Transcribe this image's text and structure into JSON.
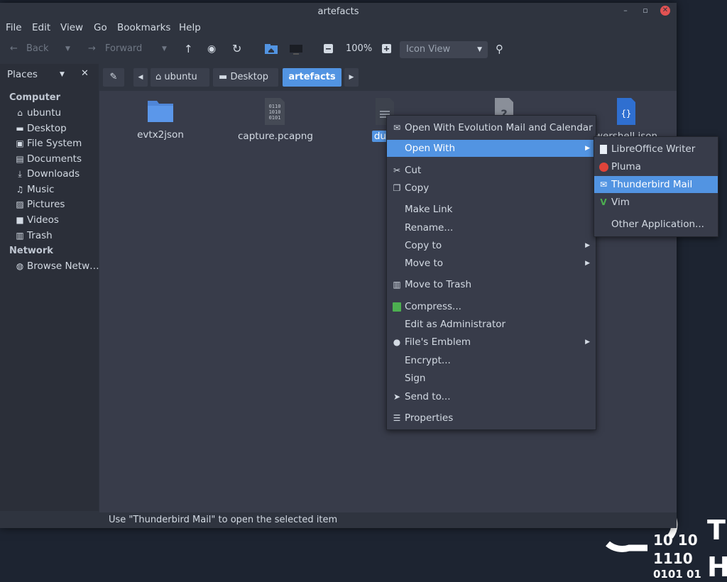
{
  "window": {
    "title": "artefacts"
  },
  "menubar": [
    "File",
    "Edit",
    "View",
    "Go",
    "Bookmarks",
    "Help"
  ],
  "toolbar": {
    "back": "Back",
    "forward": "Forward",
    "zoom": "100%",
    "view_mode": "Icon View"
  },
  "sidebar": {
    "header": "Places",
    "sections": [
      {
        "title": "Computer",
        "items": [
          {
            "label": "ubuntu",
            "icon": "home-icon"
          },
          {
            "label": "Desktop",
            "icon": "desktop-icon"
          },
          {
            "label": "File System",
            "icon": "drive-icon"
          },
          {
            "label": "Documents",
            "icon": "document-icon"
          },
          {
            "label": "Downloads",
            "icon": "download-icon"
          },
          {
            "label": "Music",
            "icon": "music-icon"
          },
          {
            "label": "Pictures",
            "icon": "pictures-icon"
          },
          {
            "label": "Videos",
            "icon": "videos-icon"
          },
          {
            "label": "Trash",
            "icon": "trash-icon"
          }
        ]
      },
      {
        "title": "Network",
        "items": [
          {
            "label": "Browse Netw…",
            "icon": "network-icon"
          }
        ]
      }
    ]
  },
  "pathbar": {
    "crumbs": [
      "ubuntu",
      "Desktop",
      "artefacts"
    ]
  },
  "files": [
    {
      "name": "evtx2json",
      "icon": "folder-icon"
    },
    {
      "name": "capture.pcapng",
      "icon": "binary-file-icon"
    },
    {
      "name": "dum",
      "icon": "text-file-icon",
      "selected": true
    },
    {
      "name": "",
      "icon": "unknown-file-icon"
    },
    {
      "name": "wershell.json",
      "icon": "json-file-icon"
    }
  ],
  "context_menu": {
    "items": [
      {
        "label": "Open With Evolution Mail and Calendar",
        "icon": "evolution-icon"
      },
      {
        "label": "Open With",
        "submenu": true,
        "highlighted": true
      },
      {
        "label": "Cut",
        "icon": "scissors-icon"
      },
      {
        "label": "Copy",
        "icon": "copy-icon"
      },
      {
        "label": "Make Link"
      },
      {
        "label": "Rename..."
      },
      {
        "label": "Copy to",
        "submenu": true
      },
      {
        "label": "Move to",
        "submenu": true
      },
      {
        "label": "Move to Trash",
        "icon": "trash-icon"
      },
      {
        "label": "Compress...",
        "icon": "archive-icon"
      },
      {
        "label": "Edit as Administrator"
      },
      {
        "label": "File's Emblem",
        "icon": "emblem-icon",
        "submenu": true
      },
      {
        "label": "Encrypt..."
      },
      {
        "label": "Sign"
      },
      {
        "label": "Send to...",
        "icon": "send-icon"
      },
      {
        "label": "Properties",
        "icon": "properties-icon"
      }
    ]
  },
  "open_with_submenu": {
    "items": [
      {
        "label": "LibreOffice Writer",
        "icon": "libreoffice-writer-icon"
      },
      {
        "label": "Pluma",
        "icon": "pluma-icon"
      },
      {
        "label": "Thunderbird Mail",
        "icon": "thunderbird-icon",
        "highlighted": true
      },
      {
        "label": "Vim",
        "icon": "vim-icon"
      },
      {
        "label": "Other Application..."
      }
    ]
  },
  "statusbar": {
    "text": "Use \"Thunderbird Mail\" to open the selected item"
  },
  "desktop_logo": {
    "digits": [
      "10 10",
      "1110",
      "0101 01"
    ],
    "letters": [
      "T",
      "H"
    ]
  },
  "colors": {
    "accent": "#5294e2",
    "window": "#2f343f",
    "content": "#383c4a",
    "sidebar": "#2b2f39",
    "desktop": "#1d2431"
  }
}
